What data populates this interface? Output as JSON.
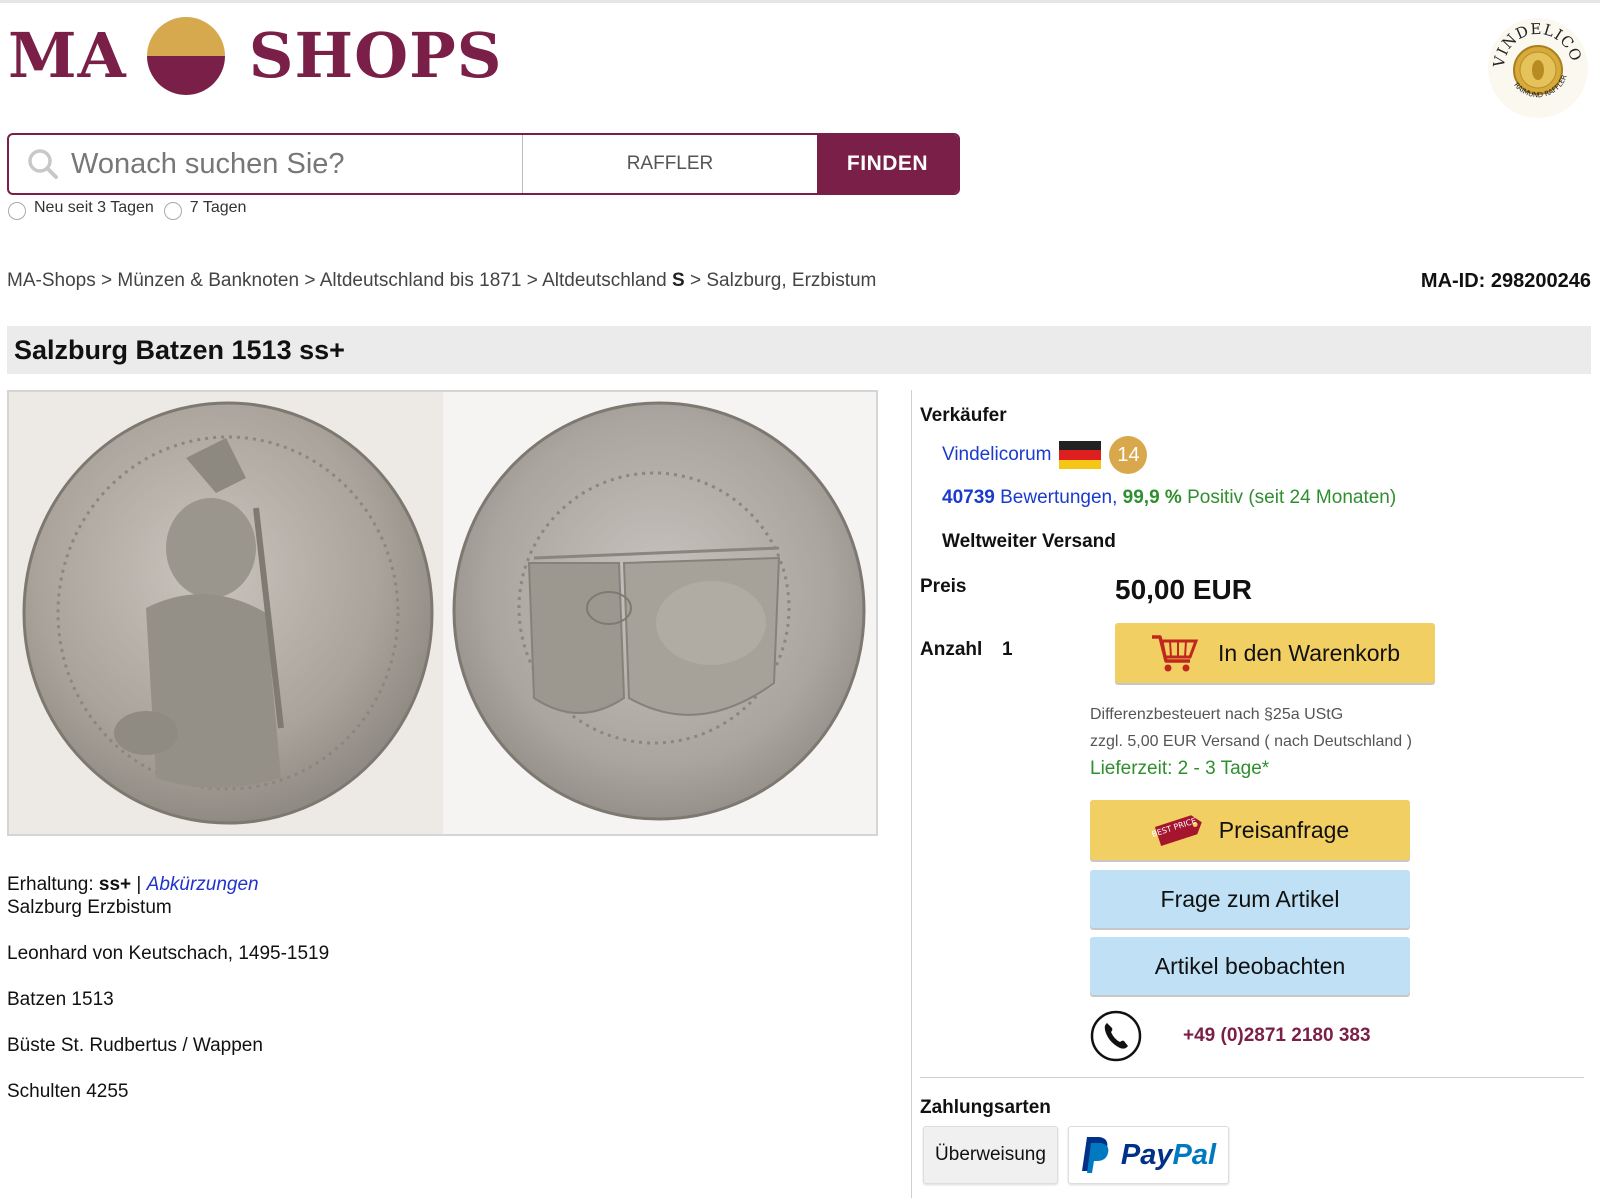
{
  "logo": {
    "left": "MA",
    "right": "SHOPS",
    "colors": {
      "brand": "#7a1f47",
      "gold": "#d6a94e"
    }
  },
  "seller_logo": {
    "icon": "vindelicorum-seal-icon",
    "text": "VINDELICORUM",
    "subtext": "RAIMUND RAFFLER"
  },
  "search": {
    "placeholder": "Wonach suchen Sie?",
    "scope": "RAFFLER",
    "button": "FINDEN"
  },
  "filters": {
    "option1": "Neu seit 3 Tagen",
    "option2": "7 Tagen"
  },
  "breadcrumb": {
    "item1": "MA-Shops",
    "item2": "Münzen & Banknoten",
    "item3": "Altdeutschland bis 1871",
    "item4a": "Altdeutschland",
    "item4b": "S",
    "item5": "Salzburg, Erzbistum",
    "sep": ">"
  },
  "ma_id": "MA-ID: 298200246",
  "title": "Salzburg Batzen 1513 ss+",
  "images": {
    "obverse": "coin-obverse-image",
    "reverse": "coin-reverse-image"
  },
  "description": {
    "condition_label": "Erhaltung:",
    "condition_value": "ss+",
    "divider": "|",
    "abbr_link": "Abkürzungen",
    "line1": "Salzburg Erzbistum",
    "line2": "Leonhard von Keutschach, 1495-1519",
    "line3": "Batzen 1513",
    "line4": "Büste St. Rudbertus / Wappen",
    "line5": "Schulten 4255"
  },
  "seller": {
    "label": "Verkäufer",
    "name": "Vindelicorum",
    "flag": "germany-flag-icon",
    "badge": "14",
    "ratings_count": "40739",
    "ratings_word": "Bewertungen",
    "comma": ",",
    "positive_pct": "99,9 %",
    "positive_text": "Positiv (seit 24 Monaten)",
    "shipping": "Weltweiter Versand"
  },
  "price": {
    "label": "Preis",
    "value": "50,00 EUR"
  },
  "quantity": {
    "label": "Anzahl",
    "value": "1"
  },
  "buttons": {
    "cart": "In den Warenkorb",
    "offer": "Preisanfrage",
    "question": "Frage zum Artikel",
    "watch": "Artikel beobachten"
  },
  "best_price_tag": "BEST PRICE",
  "tax": "Differenzbesteuert nach §25a UStG",
  "shipping_cost": "zzgl. 5,00 EUR Versand ( nach Deutschland )",
  "delivery": "Lieferzeit: 2 - 3 Tage*",
  "phone": "+49 (0)2871 2180 383",
  "payment": {
    "label": "Zahlungsarten",
    "method1": "Überweisung",
    "method2": "PayPal"
  }
}
